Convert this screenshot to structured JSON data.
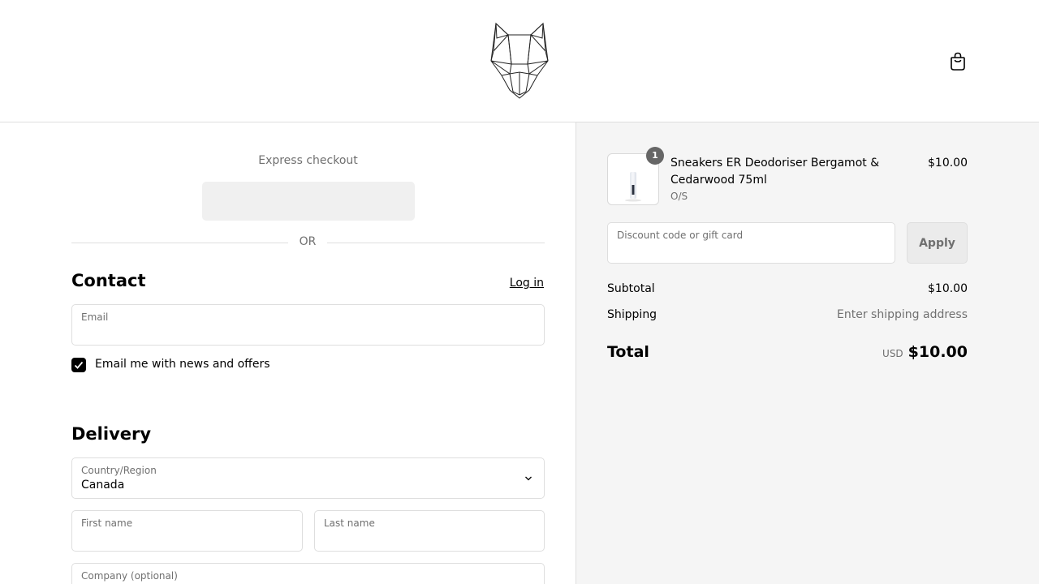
{
  "header": {
    "logo_icon": "fox-head-logo-icon",
    "cart_icon": "shopping-bag-icon"
  },
  "express": {
    "title": "Express checkout",
    "divider_text": "OR"
  },
  "contact": {
    "title": "Contact",
    "login_label": "Log in",
    "email_label": "Email",
    "email_value": "",
    "newsletter_label": "Email me with news and offers",
    "newsletter_checked": true
  },
  "delivery": {
    "title": "Delivery",
    "country_label": "Country/Region",
    "country_value": "Canada",
    "first_name_label": "First name",
    "last_name_label": "Last name",
    "company_label": "Company (optional)"
  },
  "summary": {
    "item": {
      "quantity": "1",
      "name": "Sneakers ER Deodoriser Bergamot & Cedarwood 75ml",
      "variant": "O/S",
      "price": "$10.00"
    },
    "discount_label": "Discount code or gift card",
    "apply_label": "Apply",
    "subtotal_label": "Subtotal",
    "subtotal_value": "$10.00",
    "shipping_label": "Shipping",
    "shipping_value": "Enter shipping address",
    "total_label": "Total",
    "total_currency": "USD",
    "total_value": "$10.00"
  },
  "colors": {
    "summary_bg": "#f5f5f5",
    "border": "#dedede",
    "muted_text": "#707070",
    "badge": "#666666"
  }
}
